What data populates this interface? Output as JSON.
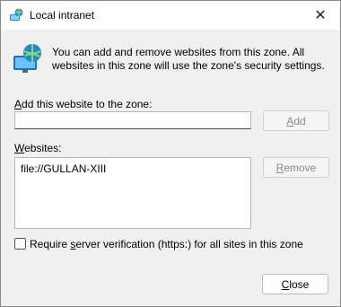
{
  "window": {
    "title": "Local intranet",
    "close_glyph": "✕"
  },
  "info": {
    "text": "You can add and remove websites from this zone. All websites in this zone will use the zone's security settings."
  },
  "add": {
    "label_accel": "A",
    "label_rest": "dd this website to the zone:",
    "input_value": "",
    "button_accel": "A",
    "button_rest": "dd"
  },
  "websites": {
    "label_accel": "W",
    "label_rest": "ebsites:",
    "items": [
      "file://GULLAN-XIII"
    ],
    "remove_accel": "R",
    "remove_rest": "emove"
  },
  "verification": {
    "label_before": "Require ",
    "label_accel": "s",
    "label_after": "erver verification (https:) for all sites in this zone",
    "checked": false
  },
  "footer": {
    "close_accel": "C",
    "close_rest": "lose"
  },
  "icons": {
    "title": "globe-monitor-icon",
    "info": "globe-monitor-icon"
  }
}
